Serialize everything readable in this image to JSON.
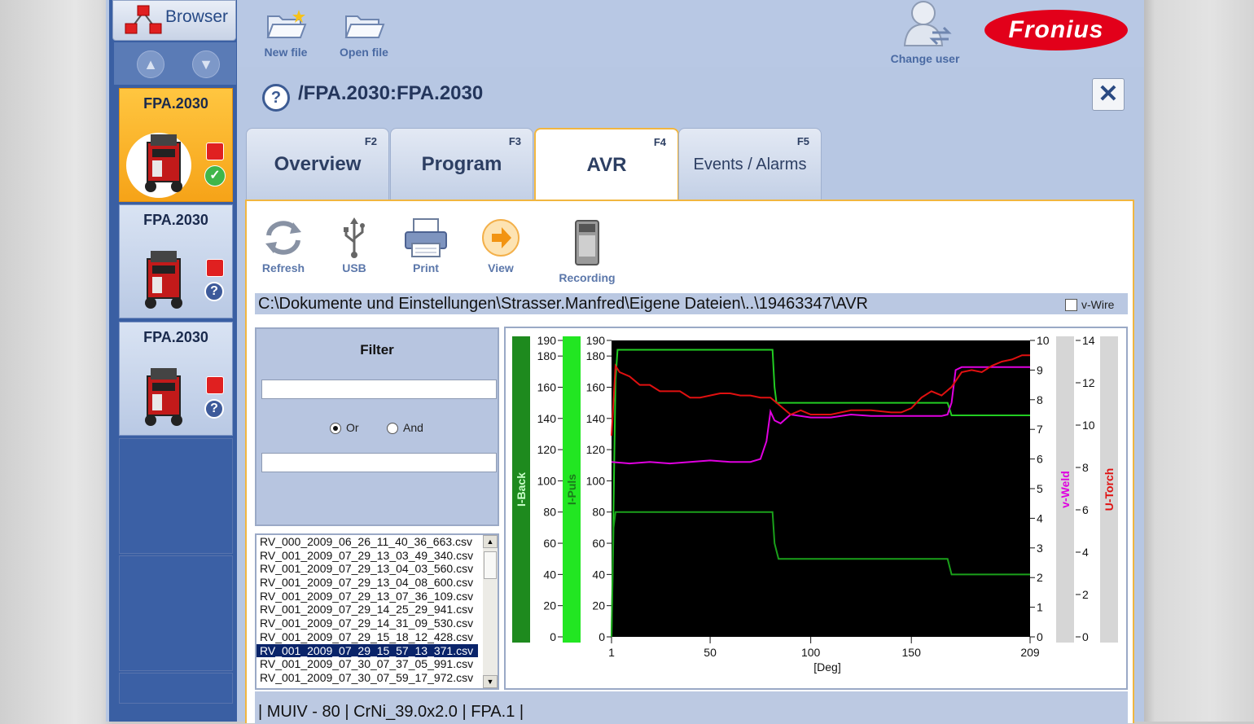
{
  "sidebar": {
    "browser_label": "Browser",
    "devices": [
      {
        "name": "FPA.2030",
        "status": "ok"
      },
      {
        "name": "FPA.2030",
        "status": "unknown"
      },
      {
        "name": "FPA.2030",
        "status": "unknown"
      }
    ]
  },
  "toolbar": {
    "new_file": "New file",
    "open_file": "Open file",
    "change_user": "Change user",
    "brand": "Fronius"
  },
  "header": {
    "title": "/FPA.2030:FPA.2030",
    "help": "?",
    "close": "✕"
  },
  "tabs": [
    {
      "key": "F2",
      "label": "Overview"
    },
    {
      "key": "F3",
      "label": "Program"
    },
    {
      "key": "F4",
      "label": "AVR",
      "selected": true
    },
    {
      "key": "F5",
      "label": "Events / Alarms"
    }
  ],
  "actions": {
    "refresh": "Refresh",
    "usb": "USB",
    "print": "Print",
    "view": "View",
    "recording": "Recording"
  },
  "path": "C:\\Dokumente und Einstellungen\\Strasser.Manfred\\Eigene Dateien\\..\\19463347\\AVR",
  "vwire": {
    "label": "v-Wire",
    "checked": false
  },
  "filter": {
    "title": "Filter",
    "input1": "",
    "input2": "",
    "or_label": "Or",
    "and_label": "And",
    "selected": "Or"
  },
  "files": [
    "RV_000_2009_06_26_11_40_36_663.csv",
    "RV_001_2009_07_29_13_03_49_340.csv",
    "RV_001_2009_07_29_13_04_03_560.csv",
    "RV_001_2009_07_29_13_04_08_600.csv",
    "RV_001_2009_07_29_13_07_36_109.csv",
    "RV_001_2009_07_29_14_25_29_941.csv",
    "RV_001_2009_07_29_14_31_09_530.csv",
    "RV_001_2009_07_29_15_18_12_428.csv",
    "RV_001_2009_07_29_15_57_13_371.csv",
    "RV_001_2009_07_30_07_37_05_991.csv",
    "RV_001_2009_07_30_07_59_17_972.csv"
  ],
  "selected_file_index": 8,
  "status_text": "| MUIV - 80 | CrNi_39.0x2.0 | FPA.1 |",
  "chart_data": {
    "type": "line",
    "xlabel": "[Deg]",
    "xlim": [
      1,
      209
    ],
    "x_ticks": [
      "1",
      "50",
      "100",
      "150",
      "209"
    ],
    "axes": {
      "I-Back": {
        "range": [
          0,
          190
        ],
        "ticks": [
          "0",
          "20",
          "40",
          "60",
          "80",
          "100",
          "120",
          "140",
          "160",
          "180",
          "190"
        ],
        "color": "#1e8a1e"
      },
      "I-Puls": {
        "range": [
          0,
          190
        ],
        "ticks": [
          "0",
          "20",
          "40",
          "60",
          "80",
          "100",
          "120",
          "140",
          "160",
          "180",
          "190"
        ],
        "color": "#22e622"
      },
      "v-Weld": {
        "range": [
          0,
          10
        ],
        "ticks": [
          "0",
          "1",
          "2",
          "3",
          "4",
          "5",
          "6",
          "7",
          "8",
          "9",
          "10"
        ],
        "color": "#e000e0"
      },
      "U-Torch": {
        "range": [
          0,
          14
        ],
        "ticks": [
          "0",
          "2",
          "4",
          "6",
          "8",
          "10",
          "12",
          "14"
        ],
        "color": "#e01010"
      }
    },
    "series": [
      {
        "name": "I-Puls",
        "axis": "I-Puls",
        "color": "#22cc22",
        "x": [
          1,
          3,
          4,
          81,
          82,
          83,
          84,
          168,
          170,
          209
        ],
        "y": [
          0,
          165,
          184,
          184,
          160,
          150,
          150,
          150,
          142,
          142
        ]
      },
      {
        "name": "I-Back",
        "axis": "I-Back",
        "color": "#1aa01a",
        "x": [
          1,
          2,
          3,
          81,
          82,
          84,
          168,
          170,
          209
        ],
        "y": [
          0,
          70,
          80,
          80,
          60,
          50,
          50,
          40,
          40
        ]
      },
      {
        "name": "v-Weld",
        "axis": "v-Weld",
        "color": "#e000e0",
        "x": [
          1,
          10,
          20,
          30,
          40,
          50,
          60,
          70,
          75,
          78,
          80,
          82,
          85,
          90,
          100,
          110,
          120,
          130,
          140,
          150,
          160,
          165,
          168,
          170,
          172,
          175,
          180,
          190,
          200,
          209
        ],
        "y": [
          5.9,
          5.85,
          5.9,
          5.85,
          5.9,
          5.95,
          5.9,
          5.9,
          6.0,
          6.6,
          7.6,
          7.3,
          7.2,
          7.5,
          7.4,
          7.4,
          7.5,
          7.45,
          7.45,
          7.45,
          7.45,
          7.45,
          7.5,
          7.9,
          9.0,
          9.1,
          9.1,
          9.1,
          9.1,
          9.1
        ]
      },
      {
        "name": "U-Torch",
        "axis": "U-Torch",
        "color": "#e01010",
        "x": [
          1,
          3,
          5,
          10,
          15,
          20,
          25,
          30,
          35,
          40,
          45,
          50,
          55,
          60,
          65,
          70,
          75,
          80,
          85,
          90,
          95,
          100,
          110,
          120,
          130,
          140,
          145,
          150,
          155,
          160,
          165,
          170,
          175,
          180,
          185,
          190,
          195,
          200,
          205,
          209
        ],
        "y": [
          9.5,
          12.8,
          12.5,
          12.3,
          11.9,
          11.9,
          11.6,
          11.6,
          11.6,
          11.3,
          11.3,
          11.4,
          11.5,
          11.5,
          11.4,
          11.4,
          11.3,
          11.3,
          10.9,
          10.5,
          10.7,
          10.5,
          10.5,
          10.7,
          10.7,
          10.6,
          10.6,
          10.8,
          11.3,
          11.6,
          11.4,
          11.8,
          12.5,
          12.6,
          12.5,
          12.8,
          13.0,
          13.1,
          13.3,
          13.3
        ]
      }
    ]
  }
}
